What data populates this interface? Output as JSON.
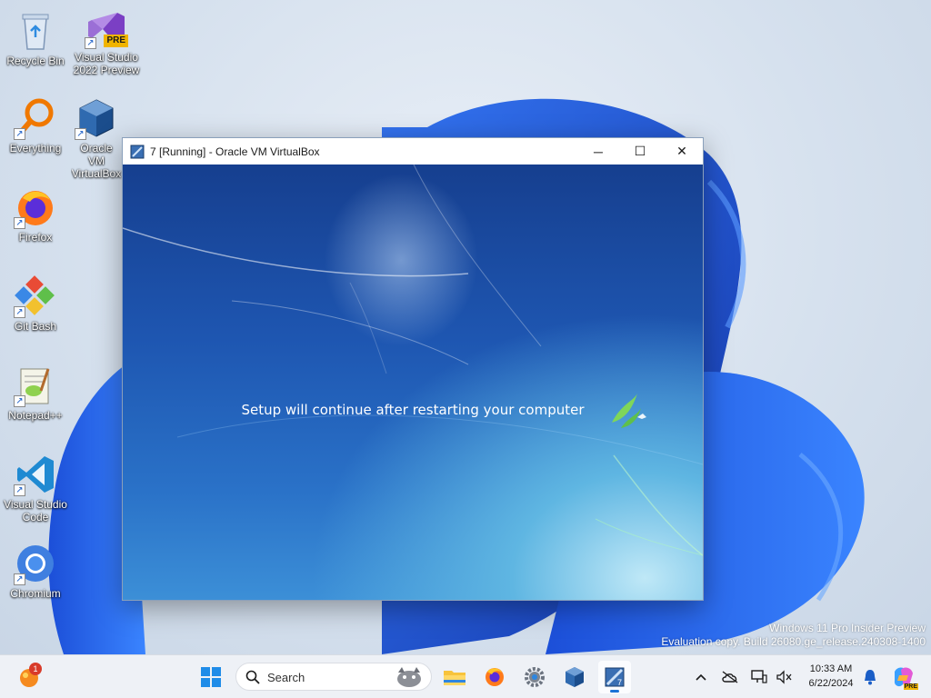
{
  "desktop": {
    "icons": [
      {
        "label": "Recycle Bin"
      },
      {
        "label": "Visual Studio 2022 Preview",
        "badge": "PRE"
      },
      {
        "label": "Everything"
      },
      {
        "label": "Oracle VM VirtualBox"
      },
      {
        "label": "Firefox"
      },
      {
        "label": "Git Bash"
      },
      {
        "label": "Notepad++"
      },
      {
        "label": "Visual Studio Code"
      },
      {
        "label": "Chromium"
      }
    ],
    "watermark": {
      "line1": "Windows 11 Pro Insider Preview",
      "line2": "Evaluation copy. Build 26080.ge_release.240308-1400"
    }
  },
  "vbox_window": {
    "title": "7 [Running] - Oracle VM VirtualBox",
    "controls": {
      "minimize": "─",
      "maximize": "☐",
      "close": "✕"
    },
    "vm_screen": {
      "message": "Setup will continue after restarting your computer"
    }
  },
  "taskbar": {
    "notification_count": "1",
    "search_placeholder": "Search",
    "pinned": [
      "start-icon",
      "file-explorer-icon",
      "firefox-icon",
      "settings-icon",
      "virtualbox-icon",
      "vm-7-icon"
    ],
    "tray": {
      "time": "10:33 AM",
      "date": "6/22/2024",
      "copilot_badge": "PRE"
    }
  },
  "colors": {
    "accent": "#1a73d6",
    "vm_blue": "#1e56b1"
  }
}
